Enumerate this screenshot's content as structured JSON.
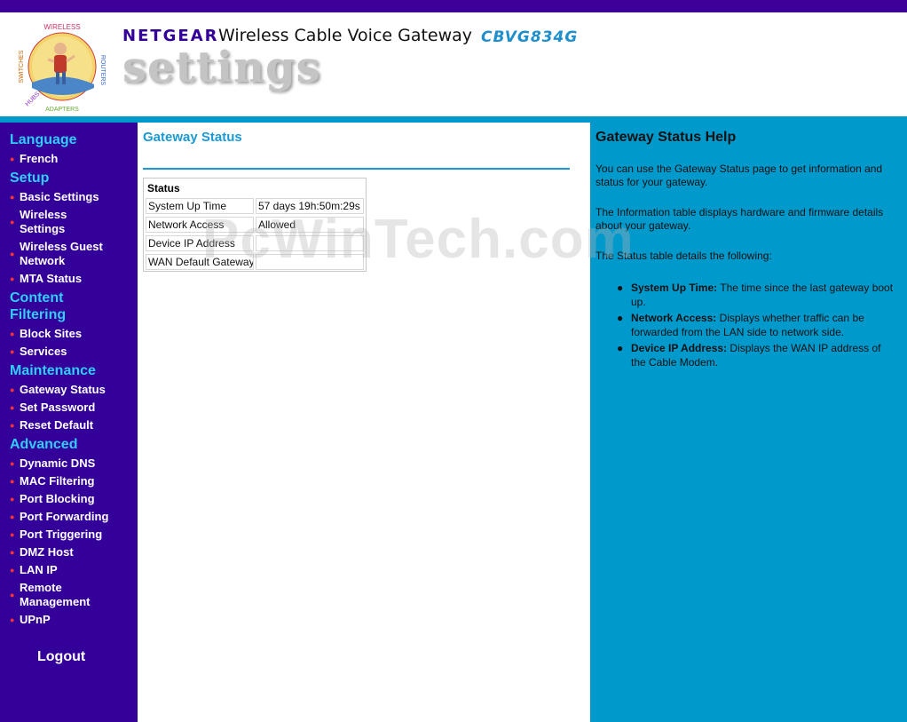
{
  "header": {
    "logo_ring_text": "SWITCHES / WIRELESS / ROUTERS / ADAPTERS / HUBS",
    "brand": "NETGEAR",
    "product": "Wireless Cable Voice Gateway",
    "model": "CBVG834G",
    "section_word": "settings"
  },
  "nav": {
    "sections": [
      {
        "heading": "Language",
        "items": [
          "French"
        ]
      },
      {
        "heading": "Setup",
        "items": [
          "Basic Settings",
          "Wireless Settings",
          "Wireless Guest Network",
          "MTA Status"
        ]
      },
      {
        "heading": "Content Filtering",
        "items": [
          "Block Sites",
          "Services"
        ]
      },
      {
        "heading": "Maintenance",
        "items": [
          "Gateway Status",
          "Set Password",
          "Reset Default"
        ]
      },
      {
        "heading": "Advanced",
        "items": [
          "Dynamic DNS",
          "MAC Filtering",
          "Port Blocking",
          "Port Forwarding",
          "Port Triggering",
          "DMZ Host",
          "LAN IP",
          "Remote Management",
          "UPnP"
        ]
      }
    ],
    "logout": "Logout"
  },
  "main": {
    "title": "Gateway Status",
    "table": {
      "header": "Status",
      "rows": [
        {
          "label": "System Up Time",
          "value": "57 days 19h:50m:29s"
        },
        {
          "label": "Network Access",
          "value": "Allowed"
        },
        {
          "label": "Device IP Address",
          "value": ""
        },
        {
          "label": "WAN Default Gateway",
          "value": ""
        }
      ]
    }
  },
  "watermark": "PcWinTech.com",
  "help": {
    "title": "Gateway Status Help",
    "p1": "You can use the Gateway Status page to get information and status for your gateway.",
    "p2": "The Information table displays hardware and firmware details about your gateway.",
    "p3": "The Status table details the following:",
    "bullets": [
      {
        "term": "System Up Time:",
        "text": " The time since the last gateway boot up."
      },
      {
        "term": "Network Access:",
        "text": " Displays whether traffic can be forwarded from the LAN side to network side."
      },
      {
        "term": "Device IP Address:",
        "text": " Displays the WAN IP address of the Cable Modem."
      }
    ]
  },
  "colors": {
    "purple": "#330099",
    "cyan": "#0099cc",
    "heading_blue": "#33ccff",
    "title_blue": "#1a9ad4",
    "bullet_red": "#ff3333"
  }
}
